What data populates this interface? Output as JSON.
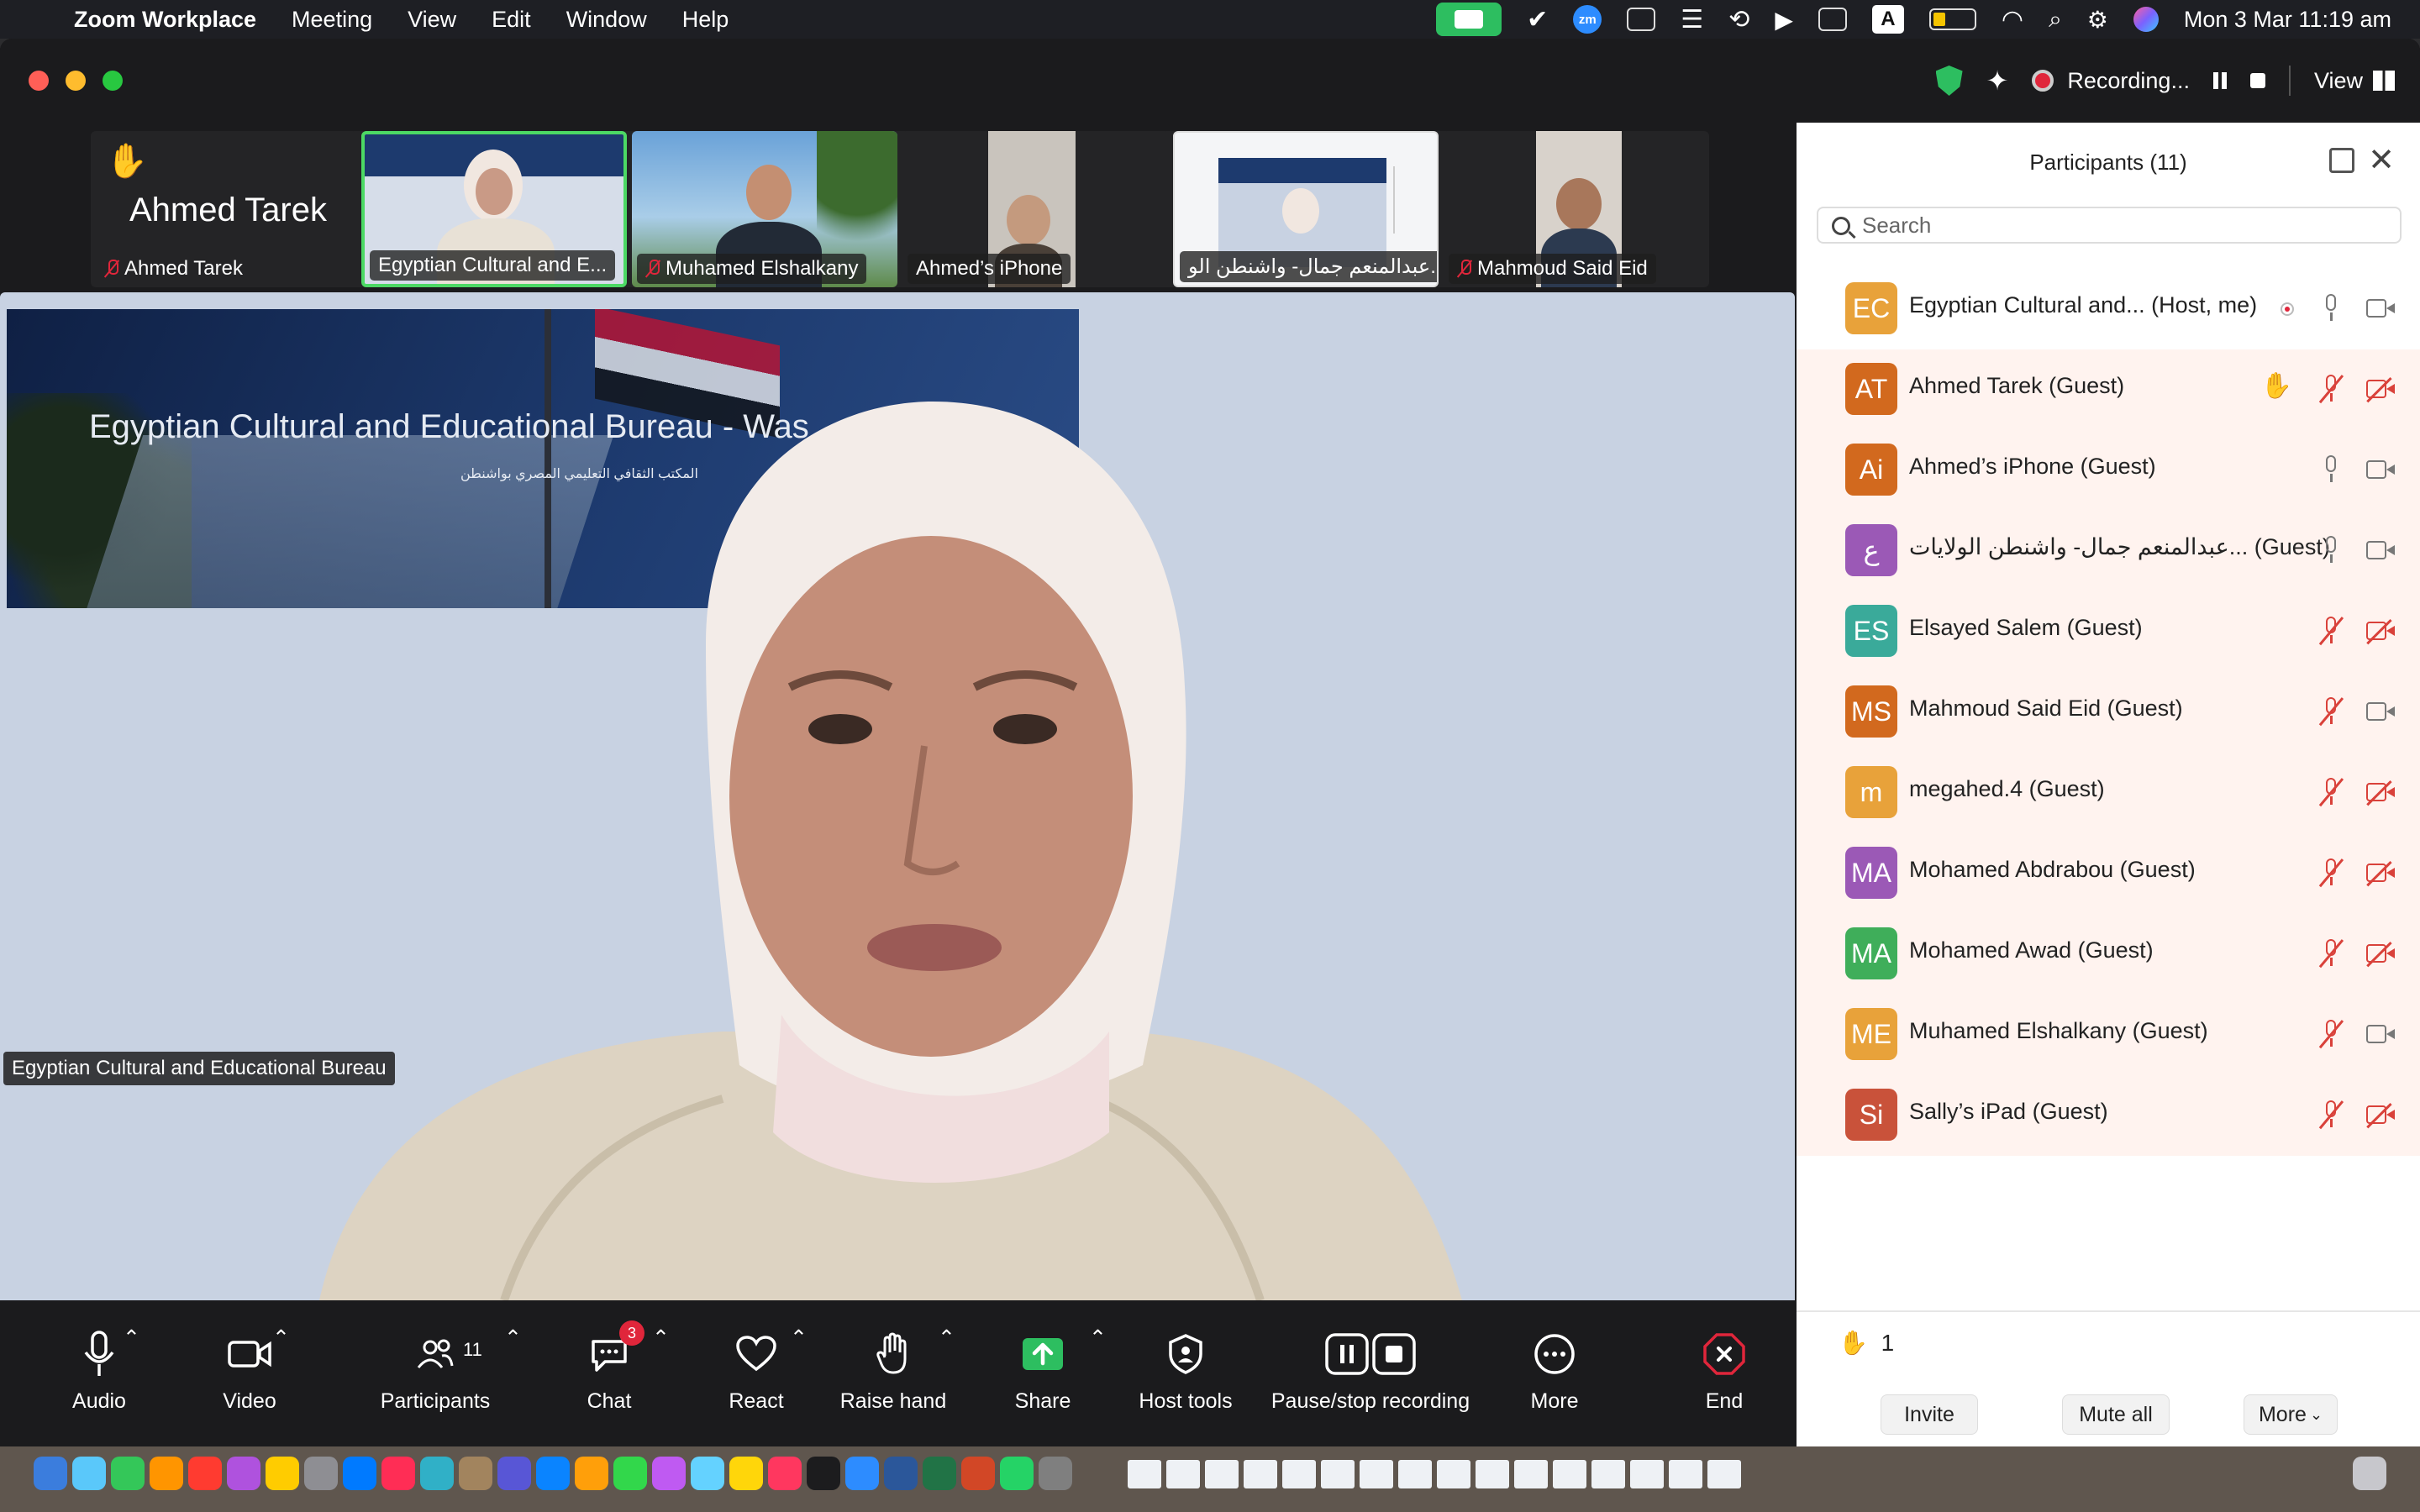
{
  "menubar": {
    "app_name": "Zoom Workplace",
    "items": [
      "Meeting",
      "View",
      "Edit",
      "Window",
      "Help"
    ],
    "datetime": "Mon 3 Mar  11:19 am",
    "tray_A": "A",
    "tray_zm": "zm"
  },
  "titlebar": {
    "recording_label": "Recording...",
    "view_label": "View"
  },
  "thumbnails": {
    "raised_hand_name": "Ahmed Tarek",
    "items": [
      {
        "name": "Ahmed Tarek",
        "muted": true
      },
      {
        "name": "Egyptian Cultural and E...",
        "muted": false,
        "active": true
      },
      {
        "name": "Muhamed Elshalkany",
        "muted": true
      },
      {
        "name": "Ahmed’s iPhone",
        "muted": false
      },
      {
        "name": "عبدالمنعم جمال- واشنطن الو...",
        "muted": false
      },
      {
        "name": "Mahmoud Said Eid",
        "muted": true
      }
    ]
  },
  "stage": {
    "banner_title": "Egyptian Cultural and Educational Bureau - Was",
    "banner_subtitle": "المكتب الثقافي التعليمي المصري بواشنطن",
    "speaker_label": "Egyptian Cultural and Educational Bureau"
  },
  "toolbar": {
    "audio": "Audio",
    "video": "Video",
    "participants": "Participants",
    "participants_count": "11",
    "chat": "Chat",
    "chat_badge": "3",
    "react": "React",
    "raise_hand": "Raise hand",
    "share": "Share",
    "host_tools": "Host tools",
    "pause_stop": "Pause/stop recording",
    "more": "More",
    "end": "End"
  },
  "panel": {
    "title": "Participants (11)",
    "search_placeholder": "Search",
    "participants": [
      {
        "initials": "EC",
        "name": "Egyptian Cultural and...   (Host, me)",
        "color": "#e8a23a",
        "mic": "on",
        "cam": "on",
        "extra": "host",
        "highlight": false
      },
      {
        "initials": "AT",
        "name": "Ahmed Tarek (Guest)",
        "color": "#d2691e",
        "mic": "off",
        "cam": "off",
        "extra": "hand",
        "highlight": true
      },
      {
        "initials": "Ai",
        "name": "Ahmed’s iPhone (Guest)",
        "color": "#d2691e",
        "mic": "on",
        "cam": "on",
        "extra": "",
        "highlight": true
      },
      {
        "initials": "ع",
        "name": "عبدالمنعم جمال- واشنطن الولايات...   (Guest)",
        "color": "#9b59b6",
        "mic": "on",
        "cam": "on",
        "extra": "",
        "highlight": true
      },
      {
        "initials": "ES",
        "name": "Elsayed Salem (Guest)",
        "color": "#3aaa9a",
        "mic": "off",
        "cam": "off",
        "extra": "",
        "highlight": true
      },
      {
        "initials": "MS",
        "name": "Mahmoud Said Eid (Guest)",
        "color": "#d2691e",
        "mic": "off",
        "cam": "on",
        "extra": "",
        "highlight": true
      },
      {
        "initials": "m",
        "name": "megahed.4 (Guest)",
        "color": "#e8a23a",
        "mic": "off",
        "cam": "off",
        "extra": "",
        "highlight": true
      },
      {
        "initials": "MA",
        "name": "Mohamed Abdrabou (Guest)",
        "color": "#9b59b6",
        "mic": "off",
        "cam": "off",
        "extra": "",
        "highlight": true
      },
      {
        "initials": "MA",
        "name": "Mohamed Awad (Guest)",
        "color": "#3fae5a",
        "mic": "off",
        "cam": "off",
        "extra": "",
        "highlight": true
      },
      {
        "initials": "ME",
        "name": "Muhamed Elshalkany (Guest)",
        "color": "#e8a23a",
        "mic": "off",
        "cam": "on",
        "extra": "",
        "highlight": true
      },
      {
        "initials": "Si",
        "name": "Sally’s iPad (Guest)",
        "color": "#c9523a",
        "mic": "off",
        "cam": "off",
        "extra": "",
        "highlight": true
      }
    ],
    "raised_count": "1",
    "invite": "Invite",
    "mute_all": "Mute all",
    "more": "More"
  },
  "colors": {
    "accent_green": "#2dbe60",
    "mute_red": "#d9413a",
    "end_red": "#e0263b"
  }
}
